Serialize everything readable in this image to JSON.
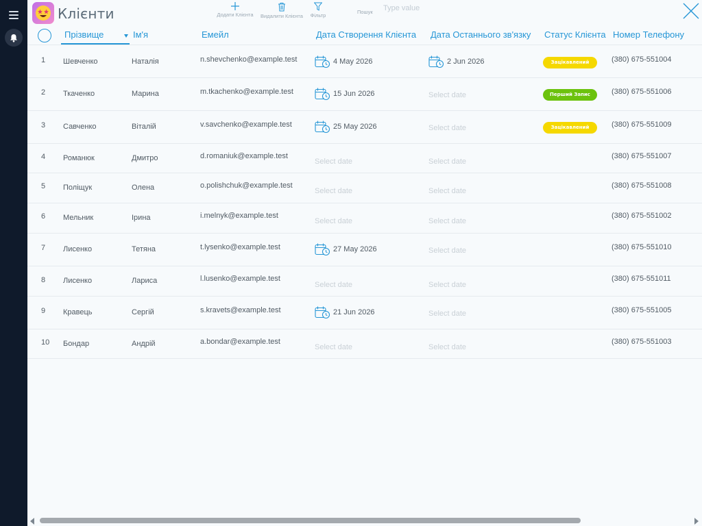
{
  "app": {
    "title": "Клієнти",
    "logo_icon": "star-struck-face-icon"
  },
  "toolbar": {
    "add_label": "Додати Клієнта",
    "delete_label": "Видалити Клієнта",
    "filter_label": "Фільтр",
    "search_label": "Пошук",
    "search_placeholder": "Type value",
    "search_value": ""
  },
  "columns": {
    "surname": "Прізвище",
    "name": "Ім'я",
    "email": "Емейл",
    "created": "Дата Створення Клієнта",
    "last_contact": "Дата Останнього зв'язку",
    "status": "Статус Клієнта",
    "phone": "Номер Телефону"
  },
  "colors": {
    "accent": "#2596d6",
    "rail": "#0f1a2b",
    "badge_yellow": "#f5d800",
    "badge_green": "#6cc20e"
  },
  "rows": [
    {
      "index": "1",
      "surname": "Шевченко",
      "name": "Наталія",
      "email": "n.shevchenko@example.test",
      "created": "4 May 2026",
      "last_contact": "2 Jun 2026",
      "status": "Зацікавлений",
      "status_color": "yellow",
      "phone": "(380) 675-551004"
    },
    {
      "index": "2",
      "surname": "Ткаченко",
      "name": "Марина",
      "email": "m.tkachenko@example.test",
      "created": "15 Jun 2026",
      "last_contact": "",
      "status": "Перший Запис",
      "status_color": "green",
      "phone": "(380) 675-551006"
    },
    {
      "index": "3",
      "surname": "Савченко",
      "name": "Віталій",
      "email": "v.savchenko@example.test",
      "created": "25 May 2026",
      "last_contact": "",
      "status": "Зацікавлений",
      "status_color": "yellow",
      "phone": "(380) 675-551009"
    },
    {
      "index": "4",
      "surname": "Романюк",
      "name": "Дмитро",
      "email": "d.romaniuk@example.test",
      "created": "",
      "last_contact": "",
      "status": "",
      "status_color": "",
      "phone": "(380) 675-551007"
    },
    {
      "index": "5",
      "surname": "Поліщук",
      "name": "Олена",
      "email": "o.polishchuk@example.test",
      "created": "",
      "last_contact": "",
      "status": "",
      "status_color": "",
      "phone": "(380) 675-551008"
    },
    {
      "index": "6",
      "surname": "Мельник",
      "name": "Ірина",
      "email": "i.melnyk@example.test",
      "created": "",
      "last_contact": "",
      "status": "",
      "status_color": "",
      "phone": "(380) 675-551002"
    },
    {
      "index": "7",
      "surname": "Лисенко",
      "name": "Тетяна",
      "email": "t.lysenko@example.test",
      "created": "27 May 2026",
      "last_contact": "",
      "status": "",
      "status_color": "",
      "phone": "(380) 675-551010"
    },
    {
      "index": "8",
      "surname": "Лисенко",
      "name": "Лариса",
      "email": "l.lusenko@example.test",
      "created": "",
      "last_contact": "",
      "status": "",
      "status_color": "",
      "phone": "(380) 675-551011"
    },
    {
      "index": "9",
      "surname": "Кравець",
      "name": "Сергій",
      "email": "s.kravets@example.test",
      "created": "21 Jun 2026",
      "last_contact": "",
      "status": "",
      "status_color": "",
      "phone": "(380) 675-551005"
    },
    {
      "index": "10",
      "surname": "Бондар",
      "name": "Андрій",
      "email": "a.bondar@example.test",
      "created": "",
      "last_contact": "",
      "status": "",
      "status_color": "",
      "phone": "(380) 675-551003"
    }
  ],
  "date_placeholder": "Select date"
}
